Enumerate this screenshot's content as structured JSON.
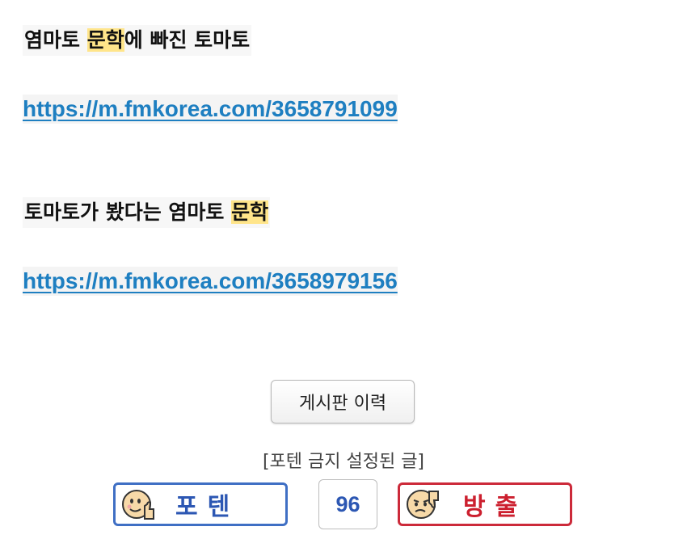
{
  "post": {
    "line1": {
      "before": "염마토 ",
      "highlight": "문학",
      "after": "에 빠진 토마토"
    },
    "link1": "https://m.fmkorea.com/3658791099",
    "line2": {
      "before": "토마토가 봤다는 염마토 ",
      "highlight": "문학",
      "after": ""
    },
    "link2": "https://m.fmkorea.com/3658979156"
  },
  "history_button": "게시판 이력",
  "notice": "[포텐 금지 설정된 글]",
  "votes": {
    "up_label": "포텐",
    "count": "96",
    "down_label": "방출"
  },
  "colors": {
    "link": "#1e7fc1",
    "highlight": "#ffe58a",
    "up": "#2c57b3",
    "down": "#cc1f2e"
  }
}
